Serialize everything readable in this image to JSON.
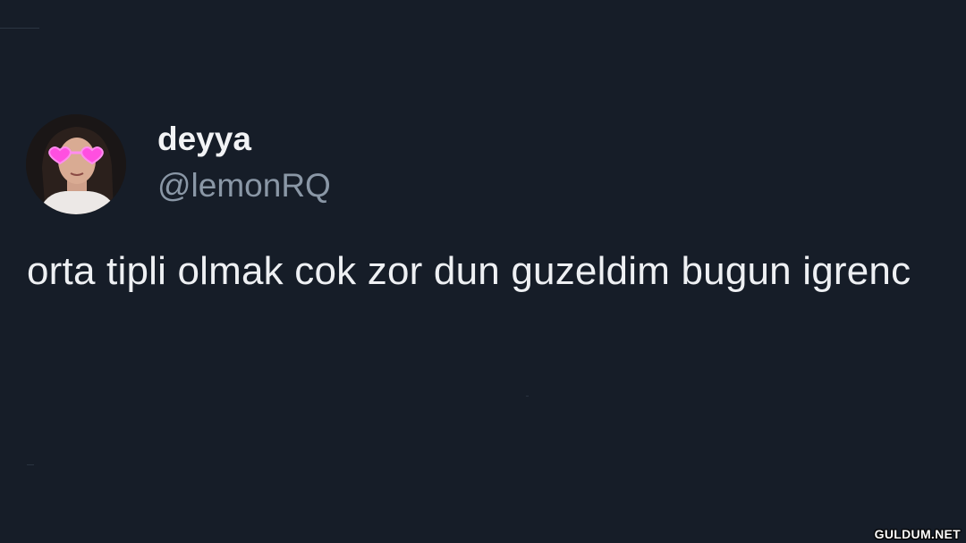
{
  "tweet": {
    "display_name": "deyya",
    "handle": "@lemonRQ",
    "text": "orta tipli olmak cok zor dun guzeldim bugun igrenc"
  },
  "avatar": {
    "description_icon": "profile-photo-icon",
    "accent_color": "#ff4fe0"
  },
  "watermark": {
    "text": "GULDUM.NET"
  },
  "colors": {
    "background": "#161d28",
    "display_name": "#f2f3f5",
    "handle": "#8a97a6",
    "body_text": "#eef0f3"
  }
}
